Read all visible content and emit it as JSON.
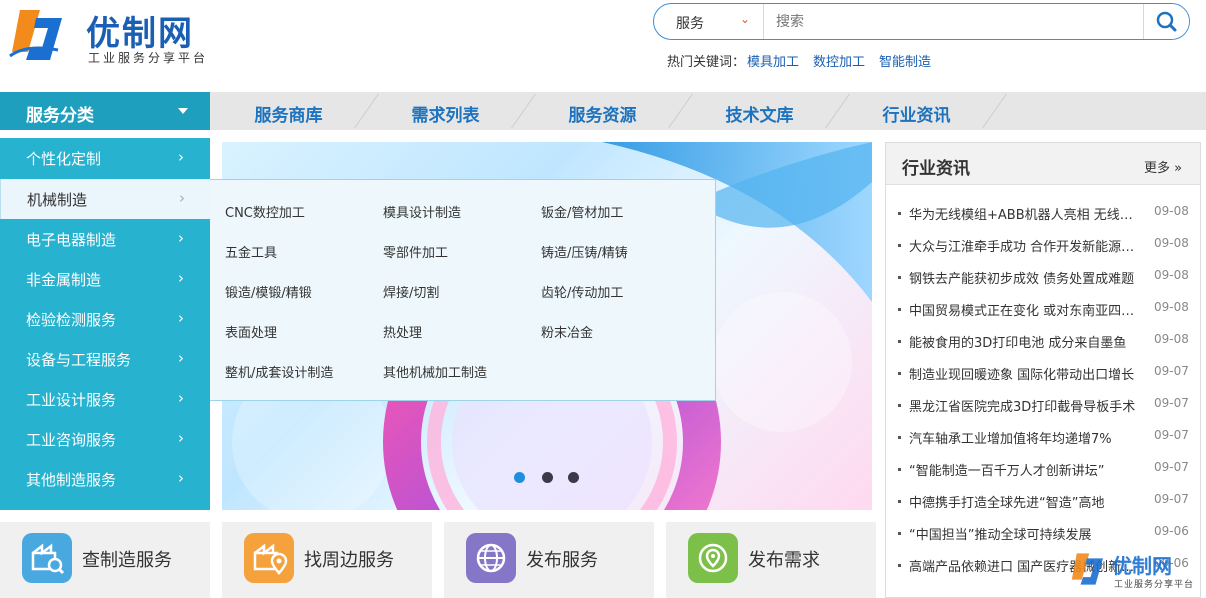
{
  "header": {
    "logo_text": "优制网",
    "logo_subtitle": "工业服务分享平台",
    "search": {
      "category": "服务",
      "placeholder": "搜索"
    },
    "hot_label": "热门关键词：",
    "hot_keywords": [
      "模具加工",
      "数控加工",
      "智能制造"
    ]
  },
  "nav": {
    "category_label": "服务分类",
    "items": [
      "服务商库",
      "需求列表",
      "服务资源",
      "技术文库",
      "行业资讯"
    ]
  },
  "sidebar": {
    "items": [
      "个性化定制",
      "机械制造",
      "电子电器制造",
      "非金属制造",
      "检验检测服务",
      "设备与工程服务",
      "工业设计服务",
      "工业咨询服务",
      "其他制造服务"
    ],
    "active_index": 1
  },
  "flyout": {
    "items": [
      "CNC数控加工",
      "模具设计制造",
      "钣金/管材加工",
      "五金工具",
      "零部件加工",
      "铸造/压铸/精铸",
      "锻造/模锻/精锻",
      "焊接/切割",
      "齿轮/传动加工",
      "表面处理",
      "热处理",
      "粉末冶金",
      "整机/成套设计制造",
      "其他机械加工制造"
    ]
  },
  "banner": {
    "slide_count": 3,
    "active_slide": 1
  },
  "news": {
    "title": "行业资讯",
    "more": "更多 »",
    "items": [
      {
        "title": "华为无线模组+ABB机器人亮相 无线助力工业智能",
        "date": "09-08"
      },
      {
        "title": "大众与江淮牵手成功 合作开发新能源汽车",
        "date": "09-08"
      },
      {
        "title": "钢铁去产能获初步成效 债务处置成难题",
        "date": "09-08"
      },
      {
        "title": "中国贸易模式正在变化 或对东南亚四国造成冲击",
        "date": "09-08"
      },
      {
        "title": "能被食用的3D打印电池 成分来自墨鱼",
        "date": "09-08"
      },
      {
        "title": "制造业现回暖迹象 国际化带动出口增长",
        "date": "09-07"
      },
      {
        "title": "黑龙江省医院完成3D打印截骨导板手术",
        "date": "09-07"
      },
      {
        "title": "汽车轴承工业增加值将年均递增7%",
        "date": "09-07"
      },
      {
        "title": "“智能制造一百千万人才创新讲坛”",
        "date": "09-07"
      },
      {
        "title": "中德携手打造全球先进“智造”高地",
        "date": "09-07"
      },
      {
        "title": "“中国担当”推动全球可持续发展",
        "date": "09-06"
      },
      {
        "title": "高端产品依赖进口 国产医疗器械创新之路",
        "date": "09-06"
      }
    ]
  },
  "tiles": [
    {
      "label": "查制造服务",
      "color": "#4aa8e0"
    },
    {
      "label": "找周边服务",
      "color": "#f5a13c"
    },
    {
      "label": "发布服务",
      "color": "#8576c8"
    },
    {
      "label": "发布需求",
      "color": "#7cc04a"
    }
  ],
  "watermark": {
    "name": "优制网",
    "subtitle": "工业服务分享平台"
  }
}
